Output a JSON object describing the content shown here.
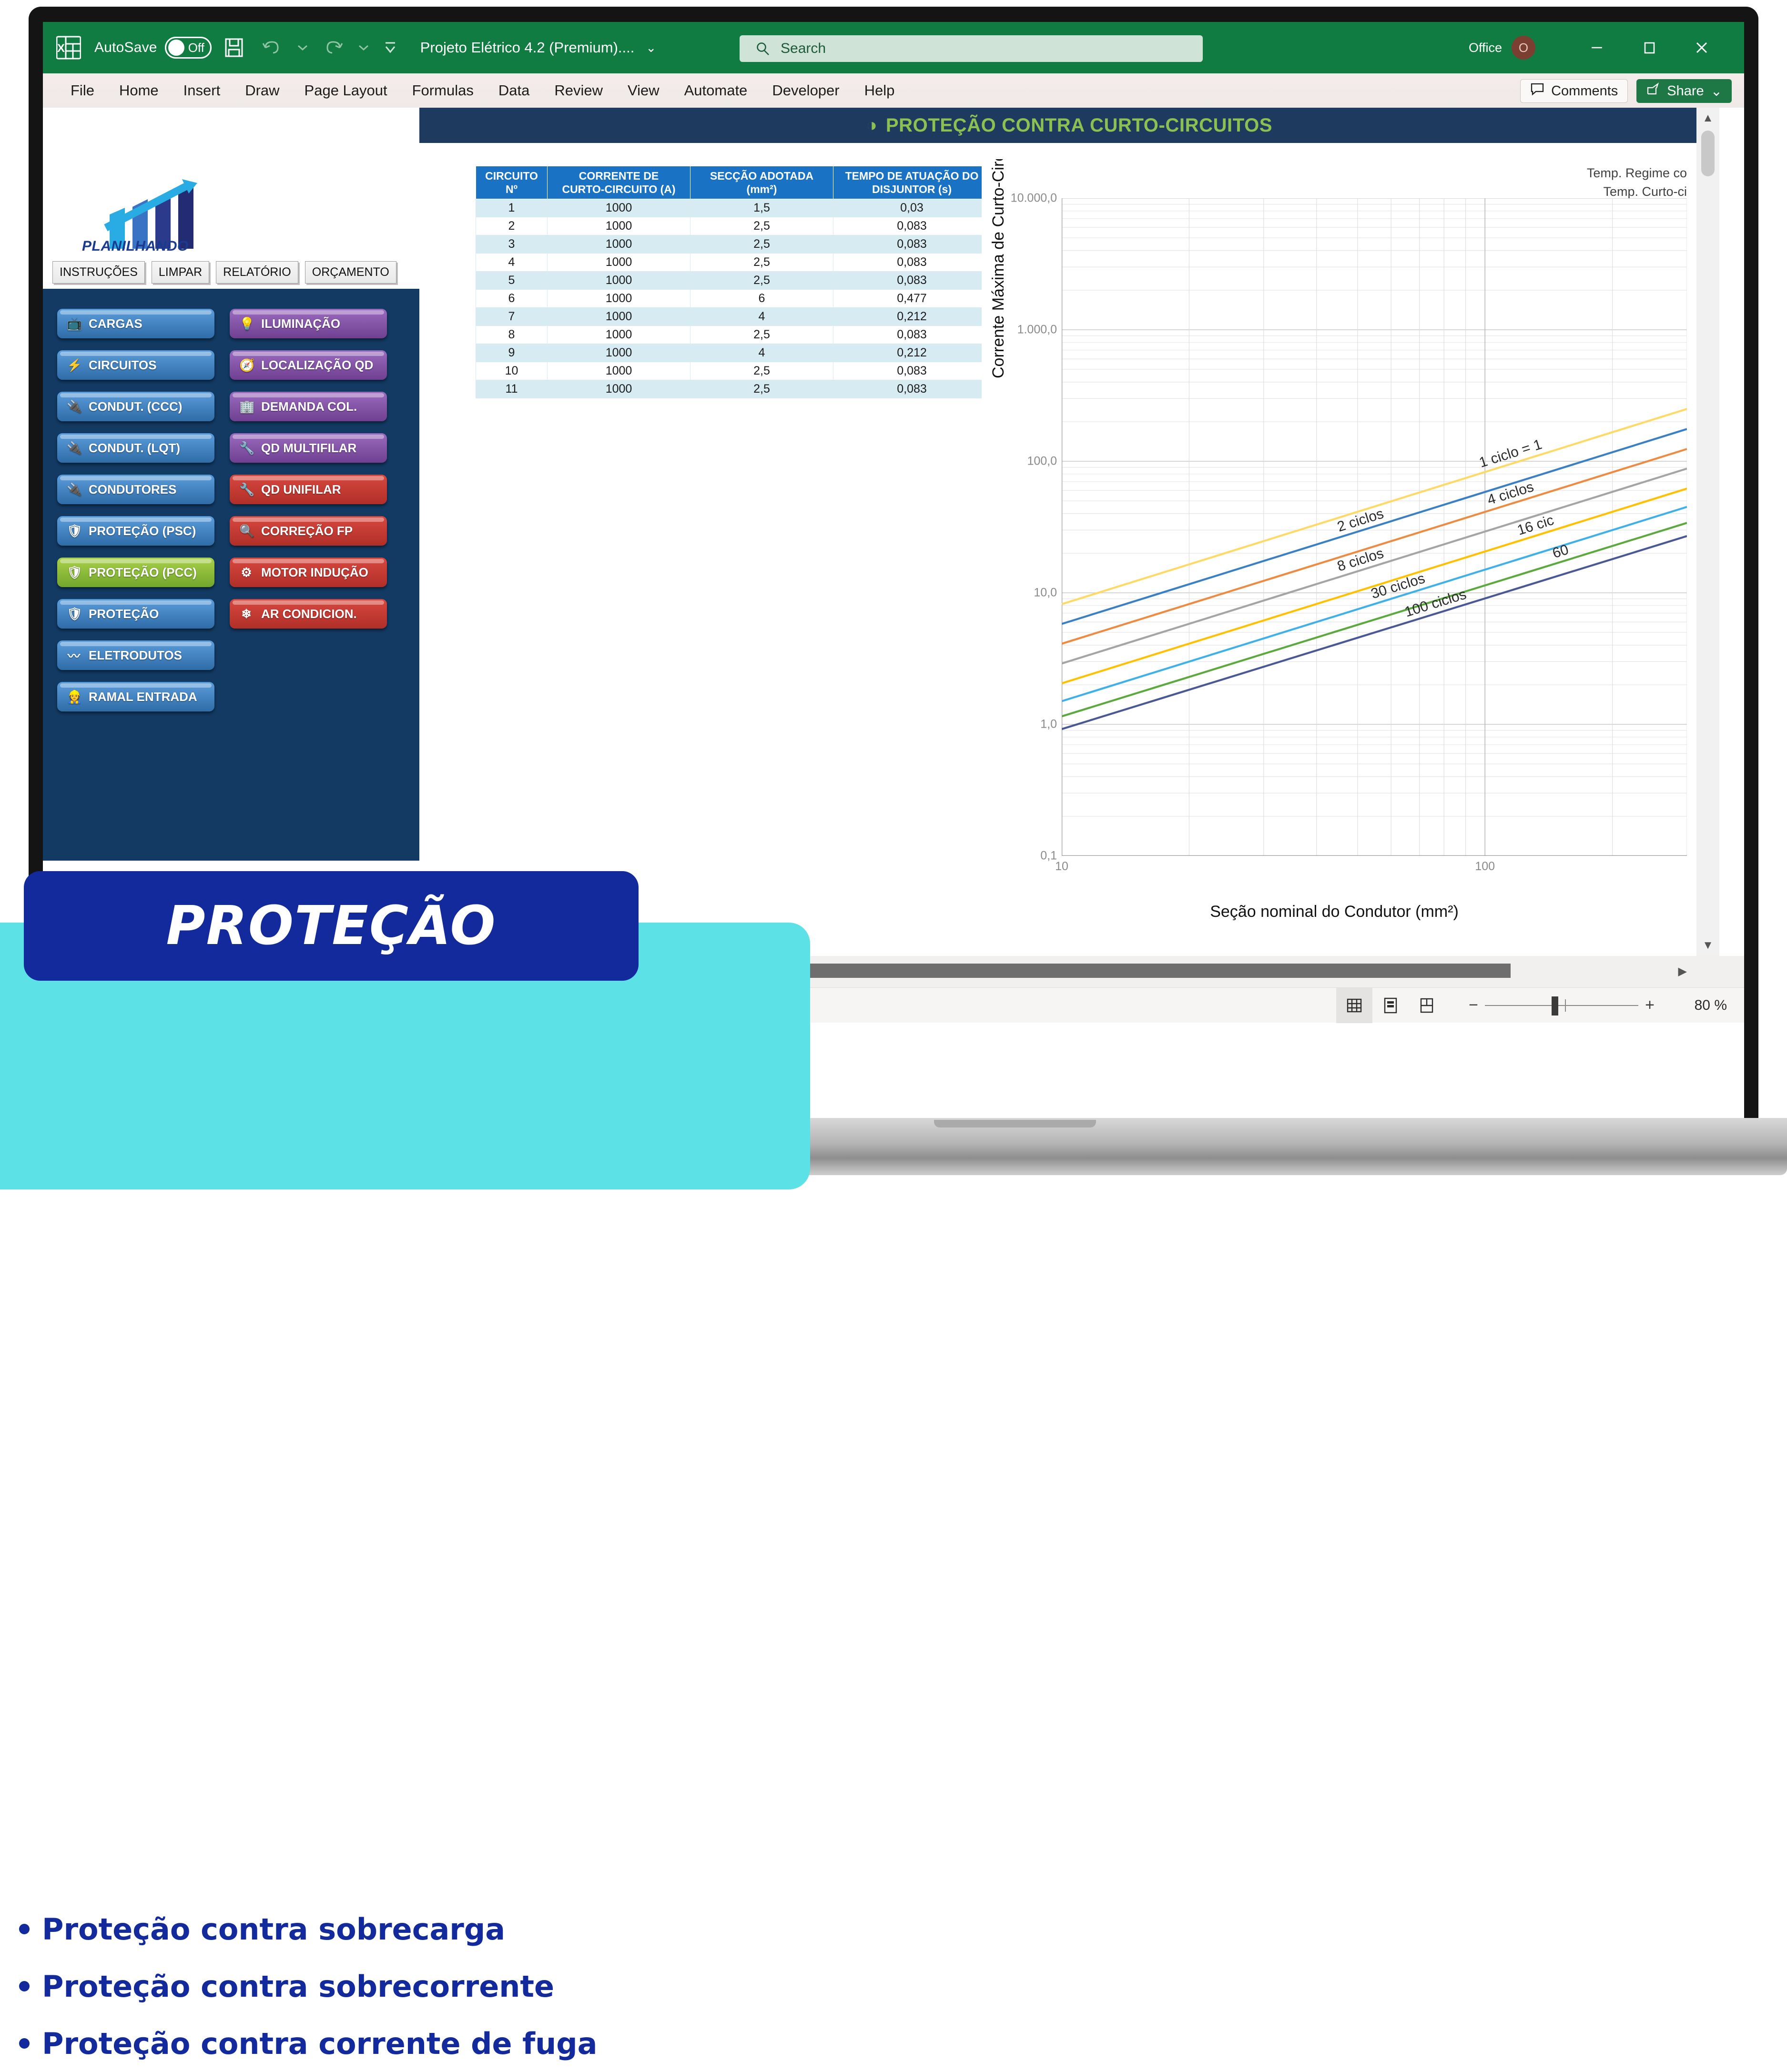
{
  "titlebar": {
    "autosave_label": "AutoSave",
    "autosave_state": "Off",
    "doc_title": "Projeto Elétrico 4.2 (Premium)....",
    "chevron": "⌄",
    "office_label": "Office",
    "avatar_initial": "O",
    "save_icon": "save-icon",
    "undo_icon": "undo-icon",
    "redo_icon": "redo-icon",
    "customize_icon": "customize-quick-access-icon",
    "minimize": "–",
    "maximize": "▢",
    "close": "✕"
  },
  "search": {
    "placeholder": "Search",
    "icon": "search-icon"
  },
  "ribbon": {
    "tabs": [
      "File",
      "Home",
      "Insert",
      "Draw",
      "Page Layout",
      "Formulas",
      "Data",
      "Review",
      "View",
      "Automate",
      "Developer",
      "Help"
    ],
    "comments_label": "Comments",
    "share_label": "Share",
    "share_chevron": "⌄"
  },
  "sidebar": {
    "logo_text": "PLANILHANDO",
    "top_buttons": [
      "INSTRUÇÕES",
      "LIMPAR",
      "RELATÓRIO",
      "ORÇAMENTO"
    ],
    "nav_left": [
      {
        "label": "CARGAS",
        "icon": "tv-icon",
        "glyph": "📺",
        "color": "blue"
      },
      {
        "label": "CIRCUITOS",
        "icon": "lightning-icon",
        "glyph": "⚡",
        "color": "blue"
      },
      {
        "label": "CONDUT. (CCC)",
        "icon": "plug-icon",
        "glyph": "🔌",
        "color": "blue"
      },
      {
        "label": "CONDUT. (LQT)",
        "icon": "plug-icon",
        "glyph": "🔌",
        "color": "blue"
      },
      {
        "label": "CONDUTORES",
        "icon": "plug-icon",
        "glyph": "🔌",
        "color": "blue"
      },
      {
        "label": "PROTEÇÃO (PSC)",
        "icon": "shield-icon",
        "glyph": "🛡",
        "color": "blue"
      },
      {
        "label": "PROTEÇÃO (PCC)",
        "icon": "shield-icon",
        "glyph": "🛡",
        "color": "green"
      },
      {
        "label": "PROTEÇÃO",
        "icon": "shield-icon",
        "glyph": "🛡",
        "color": "blue"
      },
      {
        "label": "ELETRODUTOS",
        "icon": "conduit-icon",
        "glyph": "〰",
        "color": "blue"
      },
      {
        "label": "RAMAL ENTRADA",
        "icon": "person-icon",
        "glyph": "👷",
        "color": "blue"
      }
    ],
    "nav_right": [
      {
        "label": "ILUMINAÇÃO",
        "icon": "lightbulb-icon",
        "glyph": "💡",
        "color": "purple"
      },
      {
        "label": "LOCALIZAÇÃO QD",
        "icon": "location-icon",
        "glyph": "🧭",
        "color": "purple"
      },
      {
        "label": "DEMANDA COL.",
        "icon": "building-icon",
        "glyph": "🏢",
        "color": "purple"
      },
      {
        "label": "QD MULTIFILAR",
        "icon": "screwdriver-icon",
        "glyph": "🔧",
        "color": "purple"
      },
      {
        "label": "QD UNIFILAR",
        "icon": "screwdriver-icon",
        "glyph": "🔧",
        "color": "red"
      },
      {
        "label": "CORREÇÃO FP",
        "icon": "magnifier-icon",
        "glyph": "🔍",
        "color": "red"
      },
      {
        "label": "MOTOR INDUÇÃO",
        "icon": "gear-icon",
        "glyph": "⚙",
        "color": "red"
      },
      {
        "label": "AR CONDICION.",
        "icon": "snowflake-icon",
        "glyph": "❄",
        "color": "red"
      }
    ]
  },
  "sheet": {
    "header_title": "PROTEÇÃO CONTRA CURTO-CIRCUITOS",
    "header_icon": "shield-icon",
    "header_bg": "#1e3a5f",
    "header_color": "#8cc152"
  },
  "table": {
    "headers": [
      [
        "CIRCUITO",
        "Nº"
      ],
      [
        "CORRENTE DE",
        "CURTO-CIRCUITO (A)"
      ],
      [
        "SECÇÃO ADOTADA",
        "(mm²)"
      ],
      [
        "TEMPO DE ATUAÇÃO DO",
        "DISJUNTOR (s)"
      ]
    ],
    "rows": [
      [
        "1",
        "1000",
        "1,5",
        "0,03"
      ],
      [
        "2",
        "1000",
        "2,5",
        "0,083"
      ],
      [
        "3",
        "1000",
        "2,5",
        "0,083"
      ],
      [
        "4",
        "1000",
        "2,5",
        "0,083"
      ],
      [
        "5",
        "1000",
        "2,5",
        "0,083"
      ],
      [
        "6",
        "1000",
        "6",
        "0,477"
      ],
      [
        "7",
        "1000",
        "4",
        "0,212"
      ],
      [
        "8",
        "1000",
        "2,5",
        "0,083"
      ],
      [
        "9",
        "1000",
        "4",
        "0,212"
      ],
      [
        "10",
        "1000",
        "2,5",
        "0,083"
      ],
      [
        "11",
        "1000",
        "2,5",
        "0,083"
      ]
    ]
  },
  "chart_data": {
    "type": "line",
    "title": "",
    "xlabel": "Seção nominal do Condutor (mm²)",
    "ylabel": "Corrente Máxima de Curto-Circuito (kA)",
    "xscale": "log",
    "yscale": "log",
    "xlim": [
      10,
      300
    ],
    "ylim": [
      0.1,
      10000
    ],
    "xtick_labels": [
      "10",
      "100"
    ],
    "ytick_labels": [
      "10.000,0",
      "1.000,0",
      "100,0",
      "10,0",
      "1,0",
      "0,1"
    ],
    "ytick_values": [
      10000,
      1000,
      100,
      10,
      1,
      0.1
    ],
    "grid": true,
    "legend_position": "top-right",
    "legend": [
      "Temp. Regime co",
      "Temp. Curto-ci"
    ],
    "x": [
      10,
      300
    ],
    "series": [
      {
        "name": "1 ciclo = 1...",
        "label": "1 ciclo = 1",
        "color": "#FFD966",
        "values": [
          8.2,
          250
        ]
      },
      {
        "name": "2 ciclos",
        "label": "2 ciclos",
        "color": "#3B7FC4",
        "values": [
          5.8,
          176
        ]
      },
      {
        "name": "4 ciclos",
        "label": "4 ciclos",
        "color": "#ED8B43",
        "values": [
          4.1,
          124
        ]
      },
      {
        "name": "8 ciclos",
        "label": "8 ciclos",
        "color": "#A5A5A5",
        "values": [
          2.9,
          88
        ]
      },
      {
        "name": "16 cic...",
        "label": "16 cic",
        "color": "#FFC000",
        "values": [
          2.05,
          62
        ]
      },
      {
        "name": "30 ciclos",
        "label": "30 ciclos",
        "color": "#40B0E8",
        "values": [
          1.5,
          45
        ]
      },
      {
        "name": "60 ...",
        "label": "60 ",
        "color": "#5CA93F",
        "values": [
          1.15,
          34
        ]
      },
      {
        "name": "100 ciclos",
        "label": "100 ciclos",
        "color": "#4A5896",
        "values": [
          0.92,
          27
        ]
      }
    ]
  },
  "statusbar": {
    "view_buttons": [
      "normal-view-icon",
      "page-layout-icon",
      "page-break-icon"
    ],
    "zoom_out": "−",
    "zoom_in": "+",
    "zoom_value": "80 %"
  },
  "overlay": {
    "title": "PROTEÇÃO",
    "bullets": [
      "Proteção contra sobrecarga",
      "Proteção contra sobrecorrente",
      "Proteção contra corrente de fuga"
    ]
  }
}
